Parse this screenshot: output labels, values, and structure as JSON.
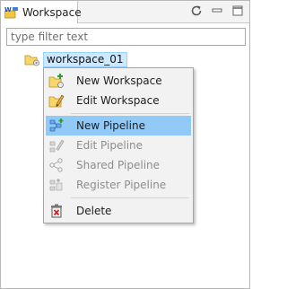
{
  "view": {
    "tab_label": "Workspace",
    "tab_icon": "workspace-view-icon",
    "toolbar": [
      {
        "name": "refresh-icon"
      },
      {
        "name": "minimize-icon"
      },
      {
        "name": "maximize-icon"
      }
    ]
  },
  "filter": {
    "value": "",
    "placeholder": "type filter text"
  },
  "tree": {
    "selected_node": {
      "label": "workspace_01",
      "icon": "workspace-folder-icon"
    }
  },
  "context_menu": {
    "items": [
      {
        "label": "New Workspace",
        "icon": "new-workspace-icon",
        "enabled": true,
        "highlighted": false
      },
      {
        "label": "Edit Workspace",
        "icon": "edit-workspace-icon",
        "enabled": true,
        "highlighted": false
      },
      {
        "label": "New Pipeline",
        "icon": "new-pipeline-icon",
        "enabled": true,
        "highlighted": true
      },
      {
        "label": "Edit Pipeline",
        "icon": "edit-pipeline-icon",
        "enabled": false,
        "highlighted": false
      },
      {
        "label": "Shared Pipeline",
        "icon": "share-icon",
        "enabled": false,
        "highlighted": false
      },
      {
        "label": "Register Pipeline",
        "icon": "register-pipeline-icon",
        "enabled": false,
        "highlighted": false
      },
      {
        "label": "Delete",
        "icon": "delete-icon",
        "enabled": true,
        "highlighted": false
      }
    ]
  },
  "colors": {
    "selection_bg": "#cde8ff",
    "menu_highlight": "#91c9f7",
    "disabled_text": "#8d8d8d"
  }
}
